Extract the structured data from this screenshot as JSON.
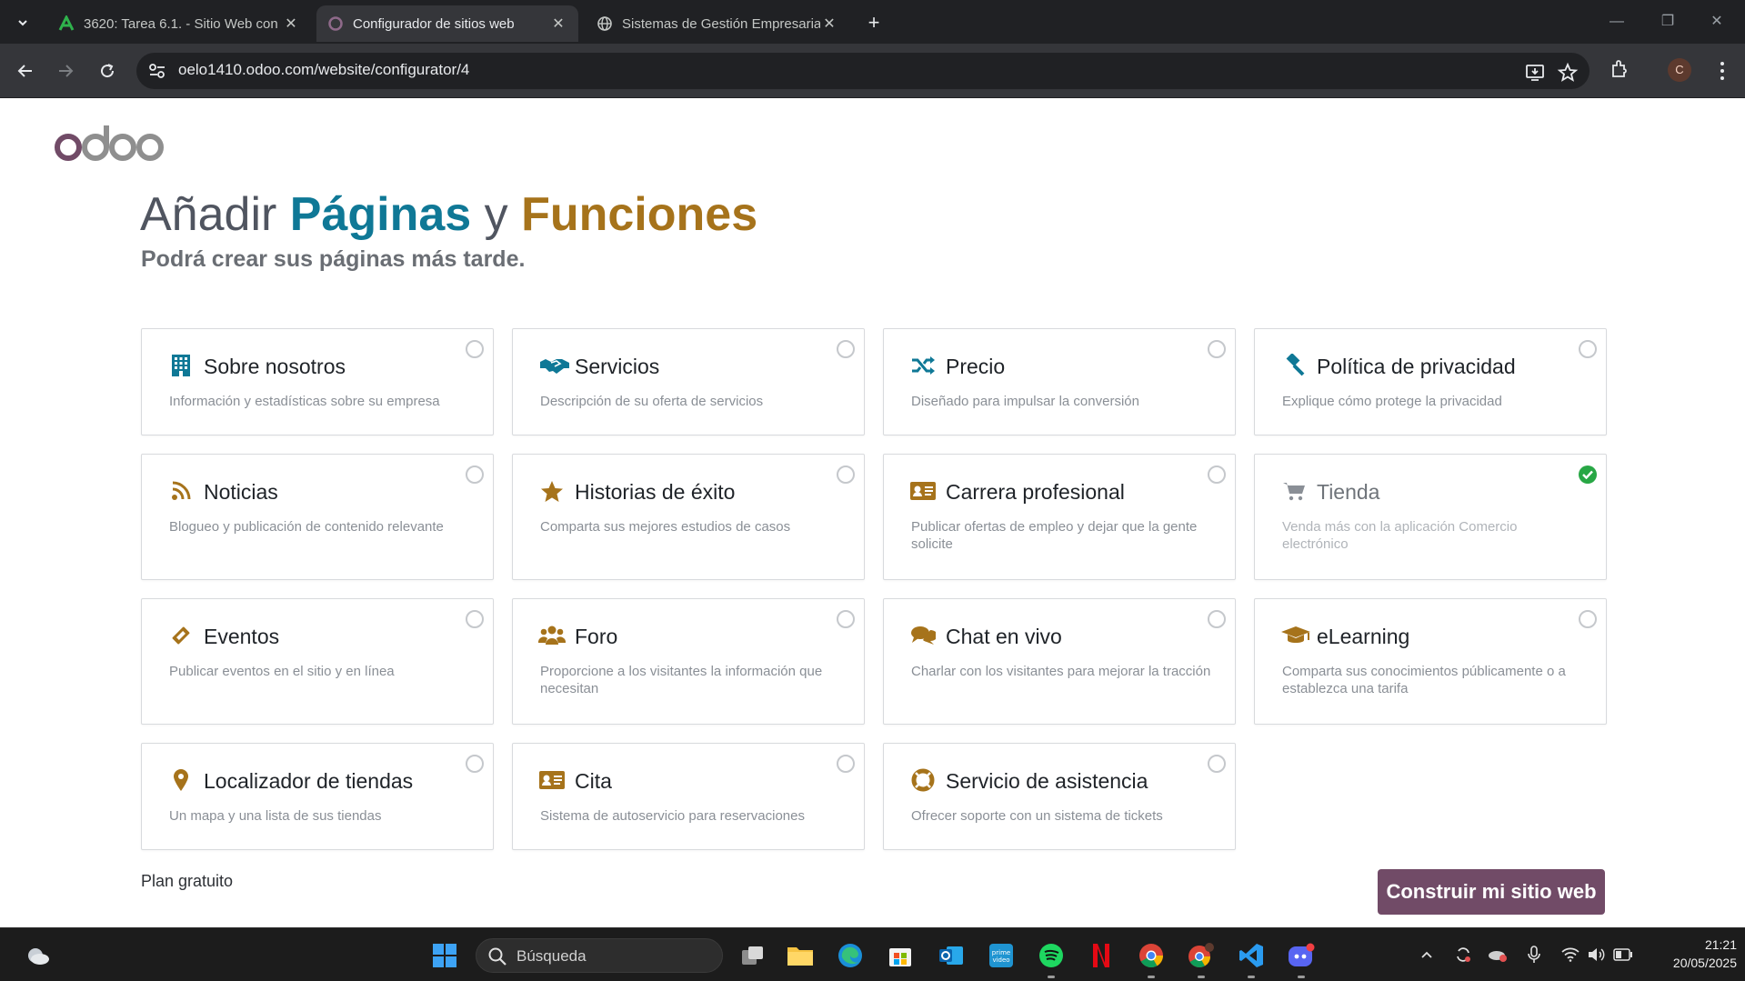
{
  "browser": {
    "tabs": [
      {
        "title": "3620: Tarea 6.1. - Sitio Web con",
        "icon": "moodle-a-icon"
      },
      {
        "title": "Configurador de sitios web",
        "icon": "odoo-circle-icon",
        "active": true
      },
      {
        "title": "Sistemas de Gestión Empresaria",
        "icon": "globe-icon"
      }
    ],
    "url": "oelo1410.odoo.com/website/configurator/4",
    "profile_initial": "C"
  },
  "page": {
    "logo_text": "odoo",
    "title_prefix": "Añadir ",
    "title_highlight1": "Páginas",
    "title_mid": " y ",
    "title_highlight2": "Funciones",
    "subtitle": "Podrá crear sus páginas más tarde.",
    "features": [
      {
        "title": "Sobre nosotros",
        "desc": "Información y estadísticas sobre su empresa",
        "icon": "building-icon",
        "icon_color": "#0f7896",
        "selected": false
      },
      {
        "title": "Servicios",
        "desc": "Descripción de su oferta de servicios",
        "icon": "handshake-icon",
        "icon_color": "#0f7896",
        "selected": false
      },
      {
        "title": "Precio",
        "desc": "Diseñado para impulsar la conversión",
        "icon": "shuffle-icon",
        "icon_color": "#0f7896",
        "selected": false
      },
      {
        "title": "Política de privacidad",
        "desc": "Explique cómo protege la privacidad",
        "icon": "gavel-icon",
        "icon_color": "#0f7896",
        "selected": false
      },
      {
        "title": "Noticias",
        "desc": "Blogueo y publicación de contenido relevante",
        "icon": "rss-icon",
        "icon_color": "#a6731b",
        "selected": false
      },
      {
        "title": "Historias de éxito",
        "desc": "Comparta sus mejores estudios de casos",
        "icon": "star-icon",
        "icon_color": "#a6731b",
        "selected": false
      },
      {
        "title": "Carrera profesional",
        "desc": "Publicar ofertas de empleo y dejar que la gente solicite",
        "icon": "id-card-icon",
        "icon_color": "#a6731b",
        "selected": false
      },
      {
        "title": "Tienda",
        "desc": "Venda más con la aplicación Comercio electrónico",
        "icon": "cart-icon",
        "icon_color": "#8a8f96",
        "selected": true
      },
      {
        "title": "Eventos",
        "desc": "Publicar eventos en el sitio y en línea",
        "icon": "ticket-icon",
        "icon_color": "#a6731b",
        "selected": false
      },
      {
        "title": "Foro",
        "desc": "Proporcione a los visitantes la información que necesitan",
        "icon": "users-icon",
        "icon_color": "#a6731b",
        "selected": false
      },
      {
        "title": "Chat en vivo",
        "desc": "Charlar con los visitantes para mejorar la tracción",
        "icon": "comments-icon",
        "icon_color": "#a6731b",
        "selected": false
      },
      {
        "title": "eLearning",
        "desc": "Comparta sus conocimientos públicamente o a establezca una tarifa",
        "icon": "graduation-cap-icon",
        "icon_color": "#a6731b",
        "selected": false
      },
      {
        "title": "Localizador de tiendas",
        "desc": "Un mapa y una lista de sus tiendas",
        "icon": "map-marker-icon",
        "icon_color": "#a6731b",
        "selected": false
      },
      {
        "title": "Cita",
        "desc": "Sistema de autoservicio para reservaciones",
        "icon": "address-card-icon",
        "icon_color": "#a6731b",
        "selected": false
      },
      {
        "title": "Servicio de asistencia",
        "desc": "Ofrecer soporte con un sistema de tickets",
        "icon": "life-ring-icon",
        "icon_color": "#a6731b",
        "selected": false
      }
    ],
    "plan_label": "Plan gratuito",
    "build_button": "Construir mi sitio web"
  },
  "taskbar": {
    "search_placeholder": "Búsqueda",
    "time": "21:21",
    "date": "20/05/2025"
  }
}
